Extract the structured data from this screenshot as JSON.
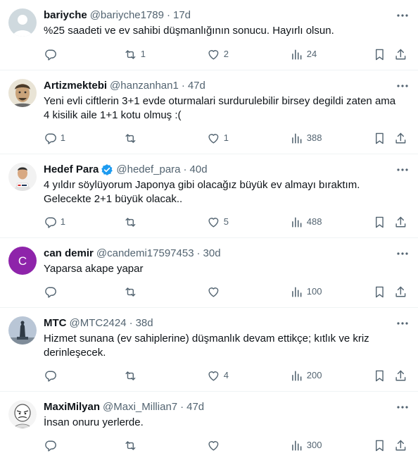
{
  "colors": {
    "text": "#0f1419",
    "muted": "#536471",
    "divider": "#eff3f4",
    "verified": "#1d9bf0"
  },
  "icons": {
    "reply": "reply-icon",
    "retweet": "retweet-icon",
    "like": "heart-icon",
    "views": "views-chart-icon",
    "bookmark": "bookmark-icon",
    "share": "share-icon",
    "more": "more-dots-icon"
  },
  "tweets": [
    {
      "name": "bariyche",
      "handle": "@bariyche1789",
      "dot": "·",
      "time": "17d",
      "text": [
        "%25 saadeti ve ev sahibi düşmanlığının sonucu. Hayırlı olsun."
      ],
      "replies": "",
      "retweets": "1",
      "likes": "2",
      "views": "24"
    },
    {
      "name": "Artizmektebi",
      "handle": "@hanzanhan1",
      "dot": "·",
      "time": "47d",
      "text": [
        "Yeni evli ciftlerin 3+1 evde oturmalari surdurulebilir birsey degildi zaten ama",
        "4 kisilik aile  1+1 kotu olmuş :("
      ],
      "replies": "1",
      "retweets": "",
      "likes": "1",
      "views": "388"
    },
    {
      "name": "Hedef Para",
      "handle": "@hedef_para",
      "dot": "·",
      "time": "40d",
      "text": [
        "4 yıldır söylüyorum Japonya gibi olacağız büyük ev almayı bıraktım.",
        "Gelecekte 2+1 büyük olacak.."
      ],
      "replies": "1",
      "retweets": "",
      "likes": "5",
      "views": "488"
    },
    {
      "name": "can demir",
      "handle": "@candemi17597453",
      "dot": "·",
      "time": "30d",
      "avatar_letter": "C",
      "text": [
        "Yaparsa akape yapar"
      ],
      "replies": "",
      "retweets": "",
      "likes": "",
      "views": "100"
    },
    {
      "name": "MTC",
      "handle": "@MTC2424",
      "dot": "·",
      "time": "38d",
      "text": [
        "Hizmet sunana (ev sahiplerine) düşmanlık devam ettikçe; kıtlık ve kriz",
        "derinleşecek."
      ],
      "replies": "",
      "retweets": "",
      "likes": "4",
      "views": "200"
    },
    {
      "name": "MaxiMilyan",
      "handle": "@Maxi_Millian7",
      "dot": "·",
      "time": "47d",
      "text": [
        "İnsan onuru yerlerde."
      ],
      "replies": "",
      "retweets": "",
      "likes": "",
      "views": "300"
    }
  ]
}
